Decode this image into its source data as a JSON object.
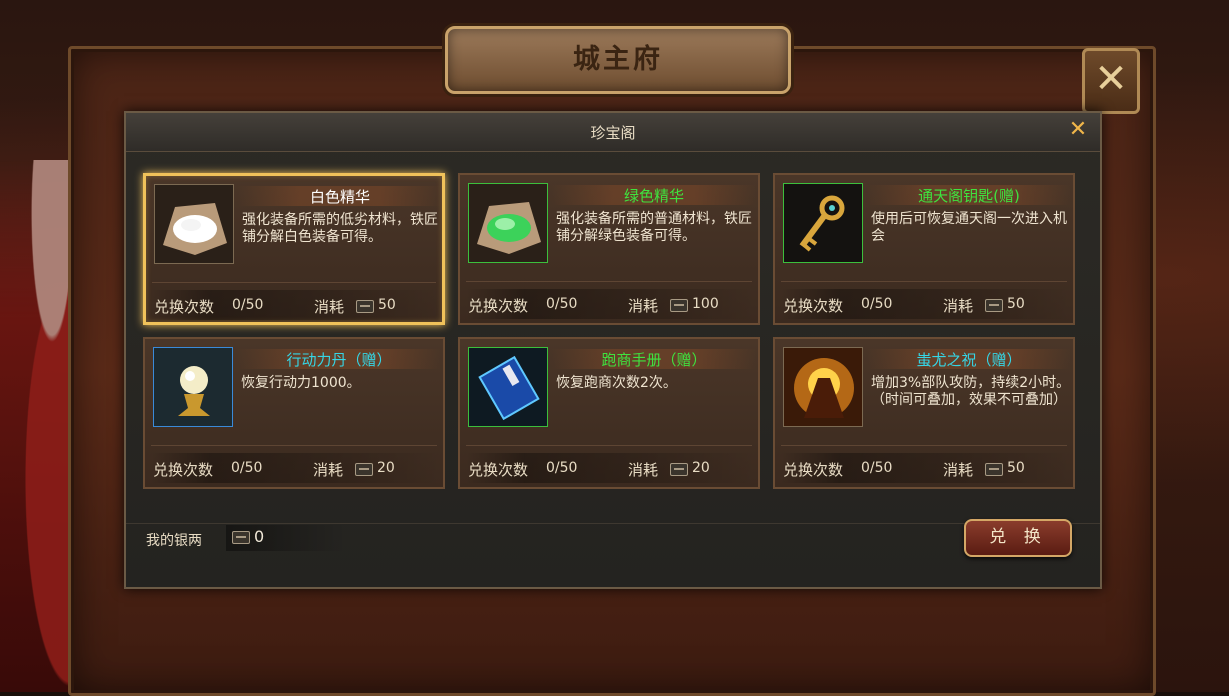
{
  "outer": {
    "title": "城主府",
    "close_icon": "✕"
  },
  "dialog": {
    "title": "珍宝阁",
    "close_icon": "✕"
  },
  "colors": {
    "white_name": "#ffffff",
    "green_name": "#3fe23f",
    "selected_border": "#f0c25a"
  },
  "count_label": "兑换次数",
  "cost_label": "消耗",
  "items": [
    {
      "name": "白色精华",
      "name_color": "#ffffff",
      "icon": "white-essence-icon",
      "desc": "强化装备所需的低劣材料，铁匠铺分解白色装备可得。",
      "count": "0/50",
      "cost": "50"
    },
    {
      "name": "绿色精华",
      "name_color": "#3fe23f",
      "icon": "green-essence-icon",
      "desc": "强化装备所需的普通材料，铁匠铺分解绿色装备可得。",
      "count": "0/50",
      "cost": "100"
    },
    {
      "name": "通天阁钥匙(赠)",
      "name_color": "#3fe23f",
      "icon": "golden-key-icon",
      "desc": "使用后可恢复通天阁一次进入机会",
      "count": "0/50",
      "cost": "50"
    },
    {
      "name": "行动力丹（赠）",
      "name_color": "#35d6e6",
      "icon": "stamina-pill-icon",
      "desc": "恢复行动力1000。",
      "count": "0/50",
      "cost": "20"
    },
    {
      "name": "跑商手册（赠）",
      "name_color": "#3fe23f",
      "icon": "trade-manual-icon",
      "desc": "恢复跑商次数2次。",
      "count": "0/50",
      "cost": "20"
    },
    {
      "name": "蚩尤之祝（赠）",
      "name_color": "#35d6e6",
      "icon": "chiyou-blessing-icon",
      "desc": "增加3%部队攻防，持续2小时。（时间可叠加，效果不可叠加）",
      "count": "0/50",
      "cost": "50"
    }
  ],
  "silver": {
    "label": "我的银两",
    "value": "0"
  },
  "exchange_button": "兑 换"
}
